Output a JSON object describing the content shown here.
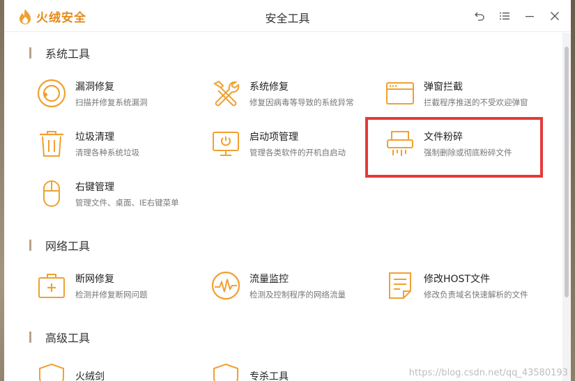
{
  "app": {
    "brand": "火绒安全",
    "title": "安全工具"
  },
  "controls": [
    {
      "name": "back-icon"
    },
    {
      "name": "menu-icon"
    },
    {
      "name": "minimize-icon"
    },
    {
      "name": "close-icon"
    }
  ],
  "sections": {
    "system": {
      "title": "系统工具"
    },
    "network": {
      "title": "网络工具"
    },
    "advanced": {
      "title": "高级工具"
    }
  },
  "tools": {
    "vuln_fix": {
      "name": "漏洞修复",
      "desc": "扫描并修复系统漏洞",
      "icon": "target-icon"
    },
    "sys_repair": {
      "name": "系统修复",
      "desc": "修复因病毒等导致的系统异常",
      "icon": "wrench-screwdriver-icon"
    },
    "popup_block": {
      "name": "弹窗拦截",
      "desc": "拦截程序推送的不受欢迎弹窗",
      "icon": "window-icon"
    },
    "junk_clean": {
      "name": "垃圾清理",
      "desc": "清理各种系统垃圾",
      "icon": "trash-icon"
    },
    "startup_mgr": {
      "name": "启动项管理",
      "desc": "管理各类软件的开机自启动",
      "icon": "monitor-power-icon"
    },
    "file_shred": {
      "name": "文件粉碎",
      "desc": "强制删除或彻底粉碎文件",
      "icon": "shredder-icon"
    },
    "context_menu": {
      "name": "右键管理",
      "desc": "管理文件、桌面、IE右键菜单",
      "icon": "mouse-icon"
    },
    "net_repair": {
      "name": "断网修复",
      "desc": "检测并修复断网问题",
      "icon": "first-aid-icon"
    },
    "traffic_mon": {
      "name": "流量监控",
      "desc": "检测及控制程序的网络流量",
      "icon": "pulse-gauge-icon"
    },
    "hosts_edit": {
      "name": "修改HOST文件",
      "desc": "修改负责域名快速解析的文件",
      "icon": "document-icon"
    },
    "adv1": {
      "name": "火绒剑",
      "icon": "shield-icon"
    },
    "adv2": {
      "name": "专杀工具",
      "icon": "shield-icon"
    }
  },
  "watermark": "https://blog.csdn.net/qq_43580193",
  "colors": {
    "accent": "#f0a030",
    "brand": "#e58a1a",
    "highlight": "#e43a3a"
  }
}
